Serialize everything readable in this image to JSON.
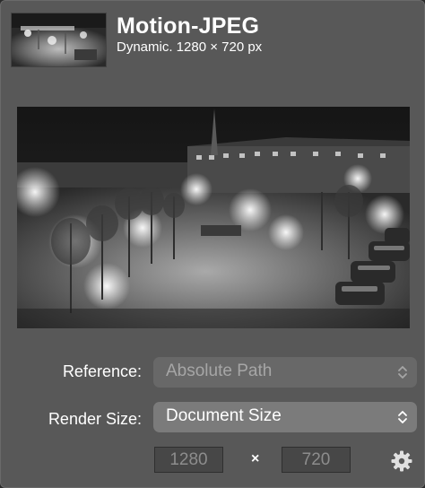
{
  "header": {
    "title": "Motion-JPEG",
    "subtitle": "Dynamic. 1280 × 720 px"
  },
  "thumbnail": {
    "description_icon": "video-thumbnail"
  },
  "preview": {
    "icon": "video-preview-image"
  },
  "reference": {
    "label": "Reference:",
    "value": "Absolute Path",
    "enabled": false
  },
  "render_size": {
    "label": "Render Size:",
    "value": "Document Size",
    "enabled": true
  },
  "dimensions": {
    "width": "1280",
    "separator": "×",
    "height": "720"
  },
  "icons": {
    "chevron": "up-down-chevron-icon",
    "settings": "gear-icon"
  },
  "colors": {
    "panel_bg": "#585858",
    "popup_enabled": "#7b7b7b",
    "popup_disabled": "#686868",
    "text_primary": "#ffffff",
    "text_disabled": "#a6a6a6"
  }
}
